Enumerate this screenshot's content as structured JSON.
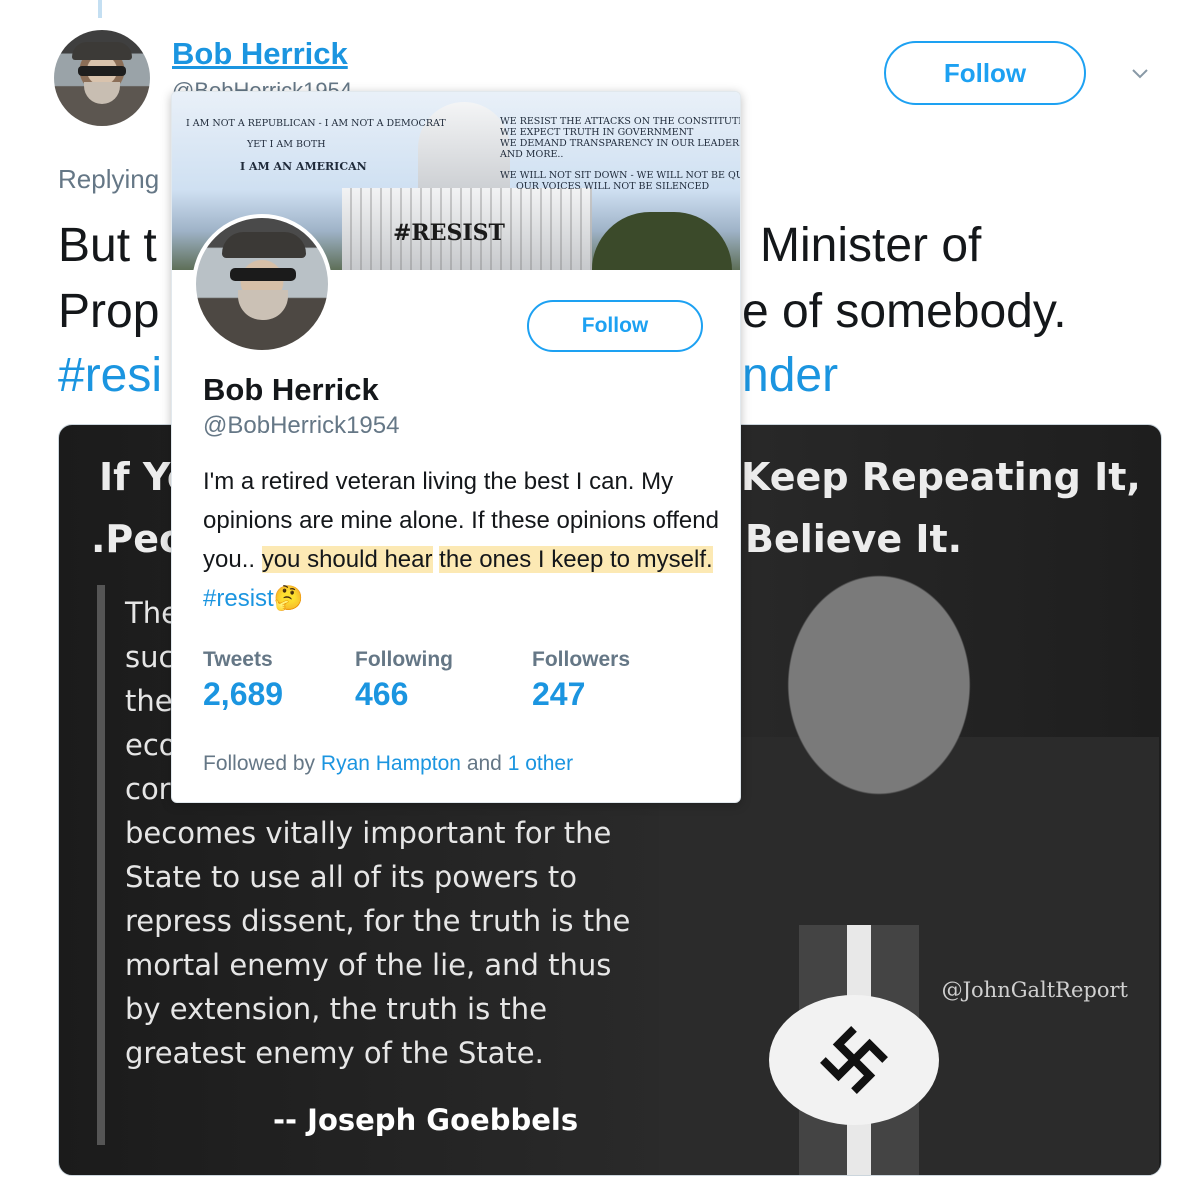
{
  "tweet": {
    "author_name": "Bob Herrick",
    "author_handle": "@BobHerrick1954",
    "follow_label": "Follow",
    "replying_prefix": "Replying",
    "line1_left": "But t",
    "line1_right": "Minister of",
    "line2_left": "Prop",
    "line2_right": "e of somebody.",
    "line3_left": "#resi",
    "line3_right": "nder"
  },
  "image": {
    "headline_1_left": "If Yo",
    "headline_1_right": "Keep Repeating It,",
    "headline_2_left": ".Peo",
    "headline_2_right": "Believe It.",
    "partial_lines": [
      "The",
      "suc",
      "the",
      "eco",
      "cor"
    ],
    "body_lines": [
      "becomes vitally important for the",
      "State to use all of its powers to",
      "repress dissent, for the truth is the",
      "mortal enemy of the lie, and thus",
      "by extension, the truth is the",
      "greatest enemy of the State."
    ],
    "quote_author": "-- Joseph Goebbels",
    "watermark": "@JohnGaltReport"
  },
  "hover_card": {
    "banner": {
      "left_line_1": "I AM NOT A REPUBLICAN - I AM NOT A DEMOCRAT",
      "left_line_2": "YET I AM BOTH",
      "left_line_3": "I AM AN AMERICAN",
      "right_line_1": "WE RESIST THE ATTACKS ON THE CONSTITUTION",
      "right_line_2": "WE EXPECT TRUTH IN GOVERNMENT",
      "right_line_3": "WE DEMAND TRANSPARENCY IN OUR LEADERS",
      "right_line_4": "AND MORE..",
      "right_line_5": "WE WILL NOT SIT DOWN - WE WILL NOT BE QUITE",
      "right_line_6": "OUR VOICES WILL NOT BE SILENCED",
      "big_text": "#RESIST"
    },
    "follow_label": "Follow",
    "name": "Bob Herrick",
    "handle": "@BobHerrick1954",
    "bio_plain": "I'm a retired veteran living the best I can. My opinions are mine alone. If these opinions offend you..",
    "bio_highlight_1": "you should hear",
    "bio_highlight_2": "the ones I keep to myself.",
    "bio_hashtag": "#resist",
    "bio_emoji": "🤔",
    "stats": {
      "tweets_label": "Tweets",
      "tweets_value": "2,689",
      "following_label": "Following",
      "following_value": "466",
      "followers_label": "Followers",
      "followers_value": "247"
    },
    "followed_by_prefix": "Followed by",
    "followed_by_name": "Ryan Hampton",
    "followed_by_and": "and",
    "followed_by_other": "1 other"
  },
  "colors": {
    "link_blue": "#1b95e0",
    "button_blue": "#1da1f2",
    "muted_gray": "#657786",
    "highlight": "#fce9b4"
  },
  "icons": {
    "chevron": "chevron-down-icon",
    "thinking_emoji": "thinking-face"
  }
}
